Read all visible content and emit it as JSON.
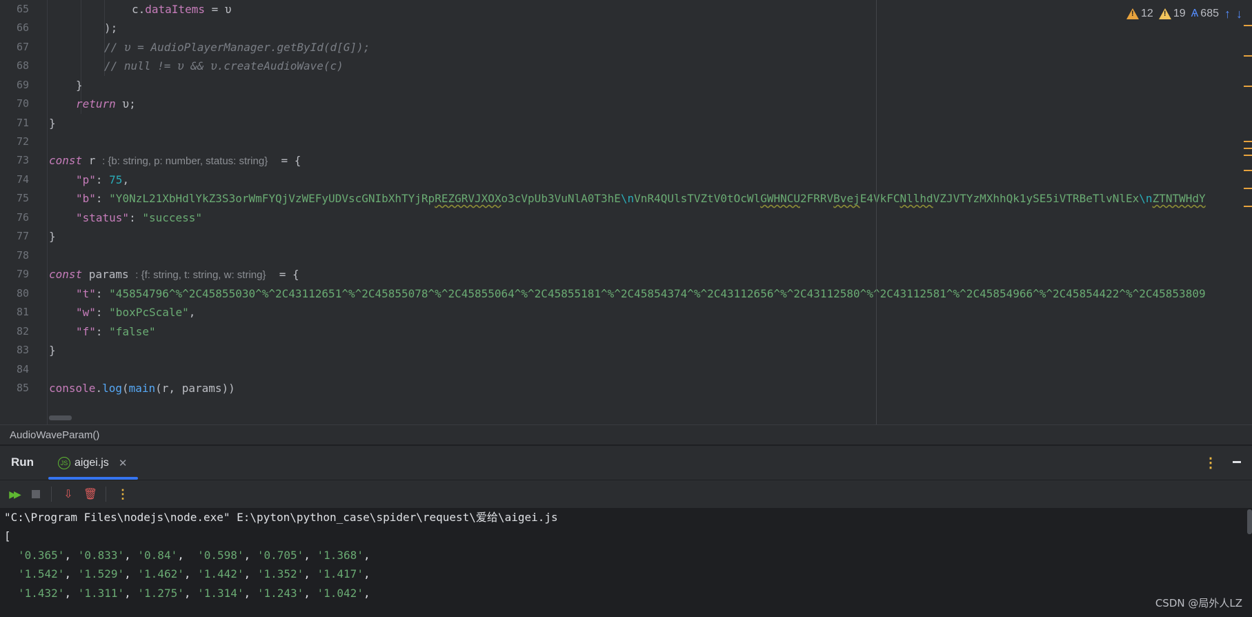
{
  "inspections": {
    "errors": "12",
    "warnings": "19",
    "typos": "685"
  },
  "gutter": {
    "lines": [
      "65",
      "66",
      "67",
      "68",
      "69",
      "70",
      "71",
      "72",
      "73",
      "74",
      "75",
      "76",
      "77",
      "78",
      "79",
      "80",
      "81",
      "82",
      "83",
      "84",
      "85"
    ]
  },
  "code": {
    "l65_a": "c.",
    "l65_b": "dataItems",
    "l65_c": " = υ",
    "l66": ");",
    "l67": "// υ = AudioPlayerManager.getById(d[G]);",
    "l68": "// null != υ && υ.createAudioWave(c)",
    "l69": "}",
    "l70_kw": "return",
    "l70_rest": " υ;",
    "l71": "}",
    "l73_kw": "const",
    "l73_name": " r",
    "l73_hint": ": {b: string, p: number, status: string}",
    "l73_rest": "  = {",
    "l74_key": "\"p\"",
    "l74_sep": ": ",
    "l74_val": "75",
    "l74_end": ",",
    "l75_key": "\"b\"",
    "l75_sep": ": ",
    "l75_v1": "\"Y0NzL21XbHdlYkZ3S3orWmFYQjVzWEFyUDVscGNIbXhTYjRp",
    "l75_v2": "REZGRVJXOX",
    "l75_v3": "o3cVpUb3VuNlA0T3hE",
    "l75_esc1": "\\n",
    "l75_v4": "VnR4QUlsTVZtV0tOcWl",
    "l75_v5": "GWHNCU",
    "l75_v6": "2FRRV",
    "l75_v7": "Bvej",
    "l75_v8": "E4VkFC",
    "l75_v9": "Nllhd",
    "l75_v10": "VZJVTYzMXhhQk1ySE5iVTRBeTlvNlEx",
    "l75_esc2": "\\n",
    "l75_v11": "ZTNTWHdY",
    "l76_key": "\"status\"",
    "l76_sep": ": ",
    "l76_val": "\"success\"",
    "l77": "}",
    "l79_kw": "const",
    "l79_name": " params",
    "l79_hint": ": {f: string, t: string, w: string}",
    "l79_rest": "  = {",
    "l80_key": "\"t\"",
    "l80_sep": ": ",
    "l80_val": "\"45854796^%^2C45855030^%^2C43112651^%^2C45855078^%^2C45855064^%^2C45855181^%^2C45854374^%^2C43112656^%^2C43112580^%^2C43112581^%^2C45854966^%^2C45854422^%^2C45853809",
    "l81_key": "\"w\"",
    "l81_sep": ": ",
    "l81_val": "\"boxPcScale\"",
    "l81_end": ",",
    "l82_key": "\"f\"",
    "l82_sep": ": ",
    "l82_val": "\"false\"",
    "l83": "}",
    "l85_a": "console",
    "l85_b": ".",
    "l85_c": "log",
    "l85_d": "(",
    "l85_e": "main",
    "l85_f": "(r, params))"
  },
  "breadcrumb": "AudioWaveParam()",
  "run_panel": {
    "title": "Run",
    "tab_label": "aigei.js",
    "tab_icon_text": "JS"
  },
  "console": {
    "cmd": "\"C:\\Program Files\\nodejs\\node.exe\" E:\\pyton\\python_case\\spider\\request\\爱给\\aigei.js",
    "open": "[",
    "row1": [
      "'0.365'",
      "'0.833'",
      "'0.84'",
      "'0.598'",
      "'0.705'",
      "'1.368'"
    ],
    "row2": [
      "'1.542'",
      "'1.529'",
      "'1.462'",
      "'1.442'",
      "'1.352'",
      "'1.417'"
    ],
    "row3": [
      "'1.432'",
      "'1.311'",
      "'1.275'",
      "'1.314'",
      "'1.243'",
      "'1.042'"
    ]
  },
  "watermark": "CSDN @局外人LZ",
  "colors": {
    "accent": "#3574f0",
    "warning": "#e8a33d",
    "string": "#6aab73"
  }
}
